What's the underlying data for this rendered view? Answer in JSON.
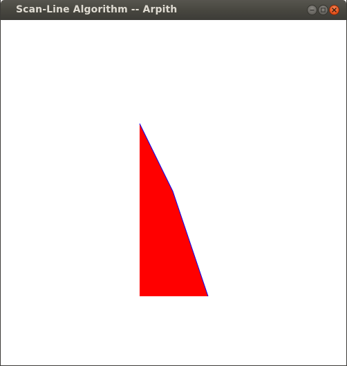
{
  "window": {
    "title": "Scan-Line Algorithm -- Arpith"
  },
  "controls": {
    "minimize_icon": "minimize-icon",
    "maximize_icon": "maximize-icon",
    "close_icon": "close-icon"
  },
  "canvas": {
    "fill_color": "#ff0000",
    "edge_color": "#0000ff",
    "background": "#ffffff"
  }
}
